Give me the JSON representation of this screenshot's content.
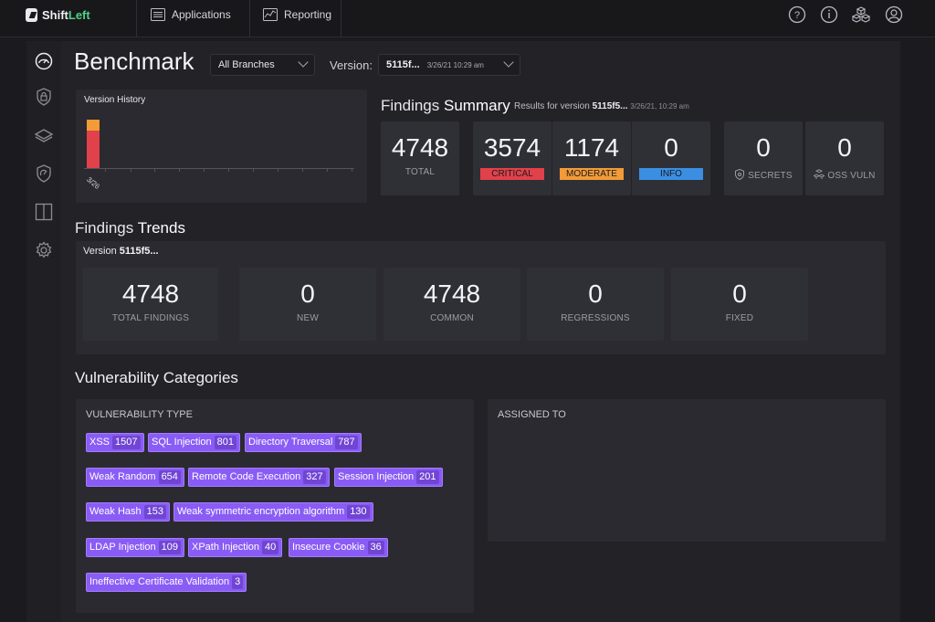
{
  "nav": {
    "logo_prefix": "Shift",
    "logo_suffix": "Left",
    "tabs": [
      {
        "label": "Applications",
        "icon": "list-icon"
      },
      {
        "label": "Reporting",
        "icon": "chart-icon"
      }
    ],
    "right_icons": [
      "help-icon",
      "info-icon",
      "cubes-icon",
      "user-icon"
    ]
  },
  "sidebar": {
    "icons": [
      "dashboard-icon",
      "lock-icon",
      "layers-icon",
      "shield-icon",
      "panels-icon",
      "gear-icon"
    ]
  },
  "header": {
    "title": "Benchmark",
    "branch_select": "All Branches",
    "version_label": "Version:",
    "version_value": "5115f...",
    "version_date": "3/26/21 10:29 am"
  },
  "version_history": {
    "title": "Version History",
    "date_label": "3/26",
    "critical": 3574,
    "moderate": 1174
  },
  "findings_summary": {
    "title_prefix": "Findings",
    "title_bold": "Summary",
    "results_prefix": "Results for version",
    "results_version": "5115f5...",
    "results_date": "3/26/21, 10:29 am",
    "cards": [
      {
        "value": "4748",
        "label": "TOTAL"
      },
      {
        "value": "3574",
        "label": "CRITICAL"
      },
      {
        "value": "1174",
        "label": "MODERATE"
      },
      {
        "value": "0",
        "label": "INFO"
      },
      {
        "value": "0",
        "label": "SECRETS"
      },
      {
        "value": "0",
        "label": "OSS VULN"
      }
    ],
    "colors": {
      "critical": "#e1414a",
      "moderate": "#f29b37",
      "info": "#3b8fe3"
    }
  },
  "findings_trends": {
    "title_prefix": "Findings",
    "title_bold": "Trends",
    "version_prefix": "Version",
    "version_value": "5115f5...",
    "cards": [
      {
        "value": "4748",
        "label": "TOTAL FINDINGS"
      },
      {
        "value": "0",
        "label": "NEW"
      },
      {
        "value": "4748",
        "label": "COMMON"
      },
      {
        "value": "0",
        "label": "REGRESSIONS"
      },
      {
        "value": "0",
        "label": "FIXED"
      }
    ]
  },
  "vulnerability_categories": {
    "title": "Vulnerability Categories",
    "type_header": "VULNERABILITY TYPE",
    "assigned_header": "ASSIGNED TO",
    "chip_color": "#8a5cf6",
    "chips": [
      {
        "label": "XSS",
        "count": "1507"
      },
      {
        "label": "SQL Injection",
        "count": "801"
      },
      {
        "label": "Directory Traversal",
        "count": "787"
      },
      {
        "label": "Weak Random",
        "count": "654"
      },
      {
        "label": "Remote Code Execution",
        "count": "327"
      },
      {
        "label": "Session Injection",
        "count": "201"
      },
      {
        "label": "Weak Hash",
        "count": "153"
      },
      {
        "label": "Weak symmetric encryption algorithm",
        "count": "130"
      },
      {
        "label": "LDAP Injection",
        "count": "109"
      },
      {
        "label": "XPath Injection",
        "count": "40"
      },
      {
        "label": "Insecure Cookie",
        "count": "36"
      },
      {
        "label": "Ineffective Certificate Validation",
        "count": "3"
      }
    ]
  }
}
